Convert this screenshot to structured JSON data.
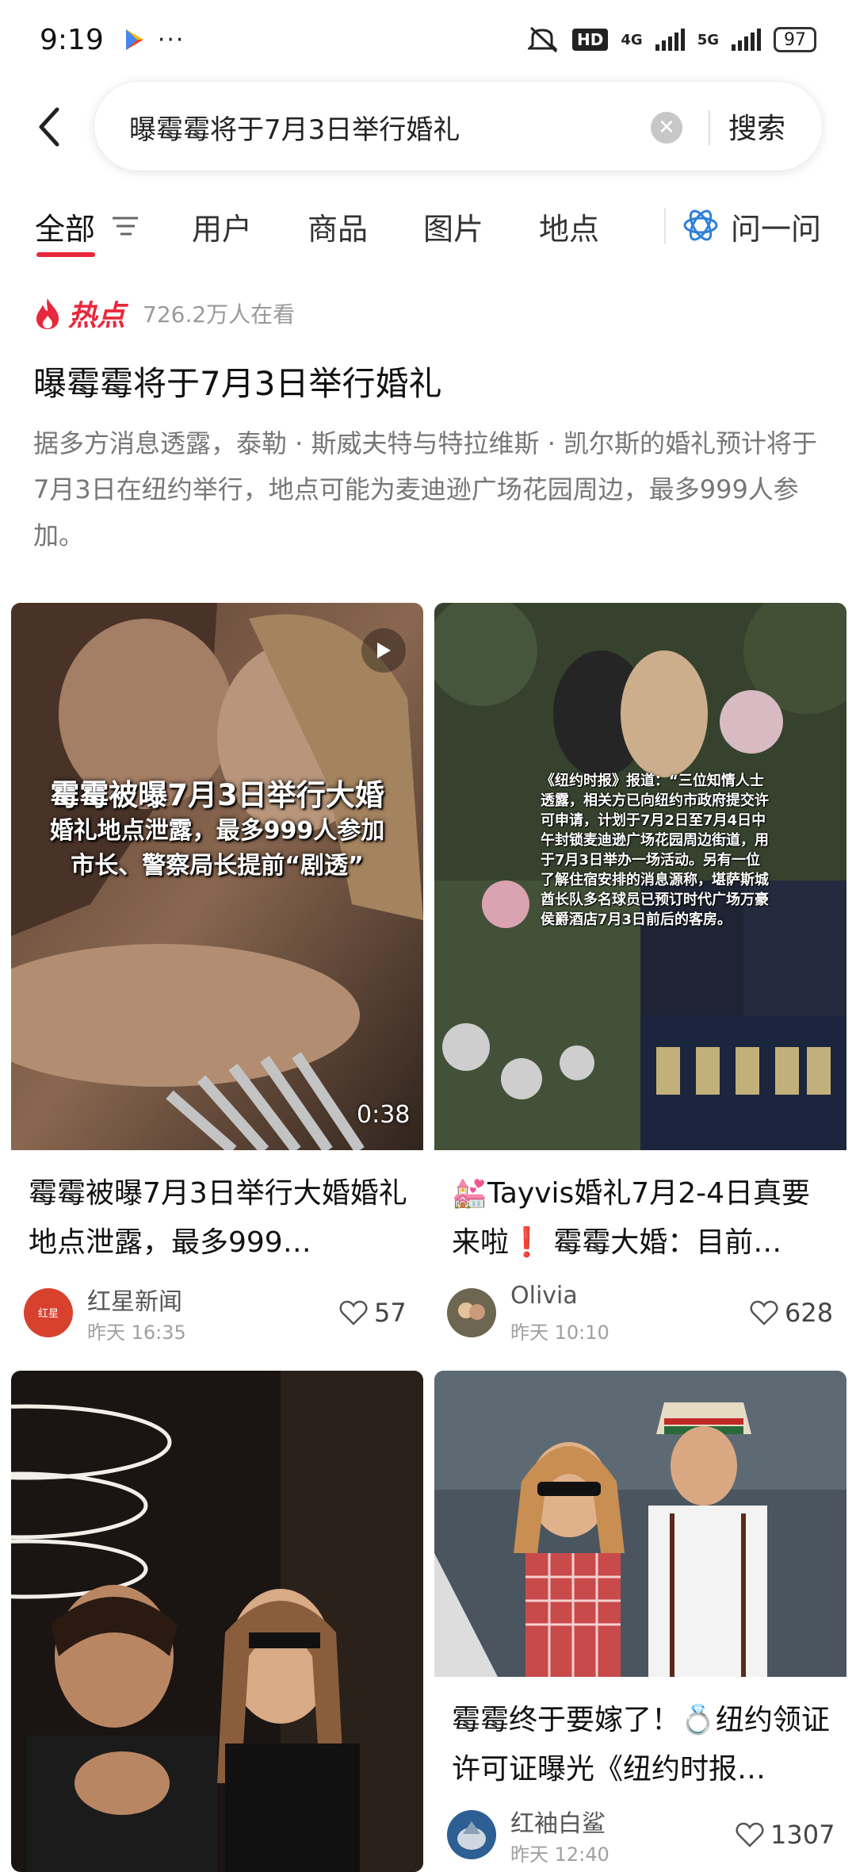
{
  "status_bar": {
    "time": "9:19",
    "hd_label": "HD",
    "net1": "4G",
    "net2": "5G",
    "battery": "97"
  },
  "search": {
    "query": "曝霉霉将于7月3日举行婚礼",
    "button_label": "搜索"
  },
  "tabs": [
    {
      "label": "全部",
      "active": true
    },
    {
      "label": "用户"
    },
    {
      "label": "商品"
    },
    {
      "label": "图片"
    },
    {
      "label": "地点"
    }
  ],
  "ask_label": "问一问",
  "hot": {
    "badge": "热点",
    "views": "726.2万人在看",
    "title": "曝霉霉将于7月3日举行婚礼",
    "description": "据多方消息透露，泰勒 · 斯威夫特与特拉维斯 · 凯尔斯的婚礼预计将于7月3日在纽约举行，地点可能为麦迪逊广场花园周边，最多999人参加。"
  },
  "cards": [
    {
      "title": "霉霉被曝7月3日举行大婚婚礼地点泄露，最多999…",
      "author": "红星新闻",
      "time": "昨天 16:35",
      "likes": "57",
      "overlay_line1": "霉霉被曝7月3日举行大婚",
      "overlay_line2": "婚礼地点泄露，最多999人参加",
      "overlay_line3": "市长、警察局长提前“剧透”",
      "duration": "0:38",
      "avatar_text": "红星新闻"
    },
    {
      "title": "💒Tayvis婚礼7月2-4日真要来啦❗ 霉霉大婚：目前…",
      "author": "Olivia",
      "time": "昨天 10:10",
      "likes": "628",
      "overlay_text": "《纽约时报》报道：“三位知情人士透露，相关方已向纽约市政府提交许可申请，计划于7月2日至7月4日中午封锁麦迪逊广场花园周边街道，用于7月3日举办一场活动。另有一位了解住宿安排的消息源称，堪萨斯城酋长队多名球员已预订时代广场万豪侯爵酒店7月3日前后的客房。"
    },
    {
      "title": "",
      "author": "",
      "time": "",
      "likes": ""
    },
    {
      "title": "霉霉终于要嫁了！💍纽约领证许可证曝光《纽约时报…",
      "author": "红袖白鲨",
      "time": "昨天 12:40",
      "likes": "1307"
    }
  ]
}
